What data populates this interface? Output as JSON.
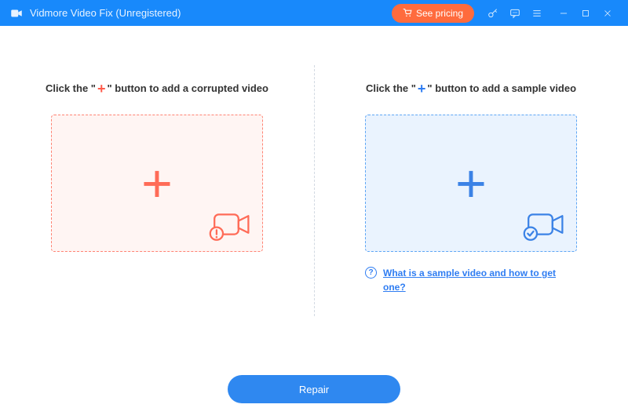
{
  "titlebar": {
    "app_title": "Vidmore Video Fix (Unregistered)",
    "see_pricing_label": "See pricing"
  },
  "left": {
    "instruction_pre": "Click the \"",
    "instruction_plus": "+",
    "instruction_post": "\" button to add a corrupted video"
  },
  "right": {
    "instruction_pre": "Click the \"",
    "instruction_plus": "+",
    "instruction_post": "\" button to add a sample video",
    "help_icon": "?",
    "help_text": "What is a sample video and how to get one?"
  },
  "footer": {
    "repair_label": "Repair"
  },
  "colors": {
    "titlebar_bg": "#1889fb",
    "accent_red": "#ff6b57",
    "accent_blue": "#2f7df2",
    "pricing_bg": "#ff6b3d"
  }
}
